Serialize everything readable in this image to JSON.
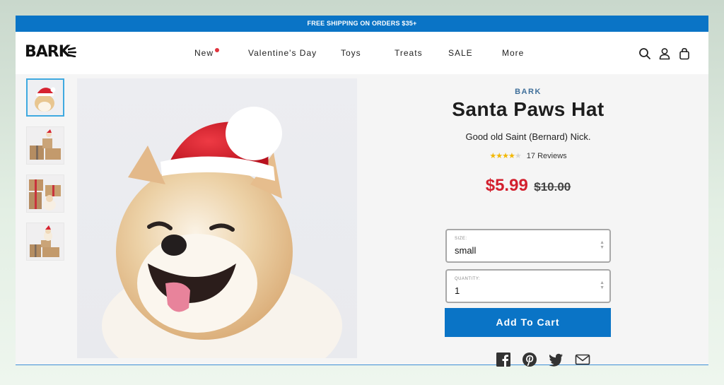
{
  "promo": {
    "text": "FREE SHIPPING ON ORDERS $35+"
  },
  "header": {
    "logo": "BARK",
    "nav": [
      {
        "label": "New",
        "has_dot": true
      },
      {
        "label": "Valentine's Day"
      },
      {
        "label": "Toys"
      },
      {
        "label": "Treats"
      },
      {
        "label": "SALE"
      },
      {
        "label": "More"
      }
    ],
    "icons": [
      "search-icon",
      "account-icon",
      "cart-icon"
    ]
  },
  "gallery": {
    "thumbnails": [
      "santa-hat-dog",
      "dog-on-gifts-wide",
      "dog-with-gift-boxes",
      "dog-on-gift-stack"
    ],
    "active_index": 0
  },
  "product": {
    "brand": "BARK",
    "title": "Santa Paws Hat",
    "subtitle": "Good old Saint (Bernard) Nick.",
    "rating": 3.5,
    "reviews_label": "17 Reviews",
    "price": "$5.99",
    "original_price": "$10.00",
    "size": {
      "label": "SIZE:",
      "value": "small"
    },
    "quantity": {
      "label": "QUANTITY:",
      "value": "1"
    },
    "add_to_cart": "Add To Cart",
    "share_icons": [
      "facebook-icon",
      "pinterest-icon",
      "twitter-icon",
      "email-icon"
    ]
  },
  "colors": {
    "brand_blue": "#0a74c6",
    "sale_red": "#d3202e",
    "star_yellow": "#f2b807"
  }
}
